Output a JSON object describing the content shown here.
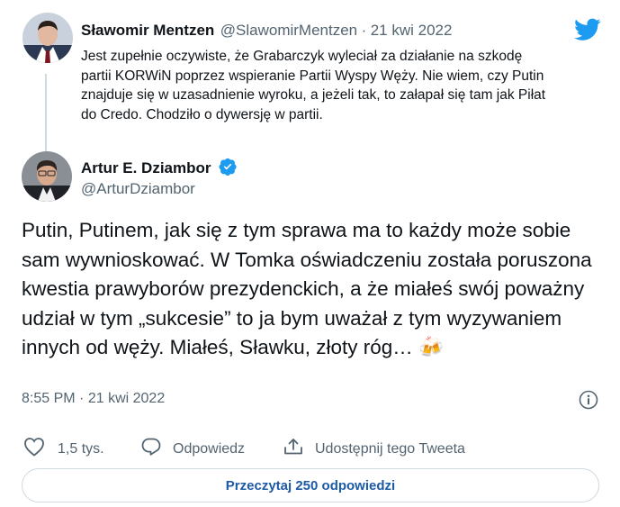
{
  "parent": {
    "name": "Sławomir Mentzen",
    "handle": "@SlawomirMentzen",
    "separator": "·",
    "date": "21 kwi 2022",
    "text": "Jest zupełnie oczywiste, że Grabarczyk wyleciał za działanie na szkodę partii KORWiN poprzez wspieranie Partii Wyspy Węży. Nie wiem, czy Putin znajduje się w uzasadnienie wyroku, a jeżeli tak, to załapał się tam jak Piłat do Credo. Chodziło o dywersję w partii."
  },
  "tweet": {
    "name": "Artur E. Dziambor",
    "handle": "@ArturDziambor",
    "text": "Putin, Putinem, jak się z tym sprawa ma to każdy może sobie sam wywnioskować. W Tomka oświadczeniu została poruszona kwestia prawyborów prezydenckich, a że miałeś swój poważny udział w tym „sukcesie” to ja bym uważał z tym wyzywaniem innych od węży. Miałeś, Sławku, złoty róg…",
    "emoji": "🍻",
    "time": "8:55 PM",
    "separator": "·",
    "date": "21 kwi 2022"
  },
  "actions": {
    "likes": "1,5 tys.",
    "reply_label": "Odpowiedz",
    "share_label": "Udostępnij tego Tweeta"
  },
  "read_replies_label": "Przeczytaj 250 odpowiedzi",
  "colors": {
    "twitter_blue": "#1d9bf0",
    "text": "#0f1419",
    "muted": "#536471",
    "link": "#1d5aa5",
    "border": "#cfd9de"
  },
  "icons": {
    "logo": "twitter-bird-icon",
    "verified": "verified-badge-icon",
    "info": "info-icon",
    "like": "heart-icon",
    "reply": "speech-bubble-icon",
    "share": "share-icon"
  }
}
